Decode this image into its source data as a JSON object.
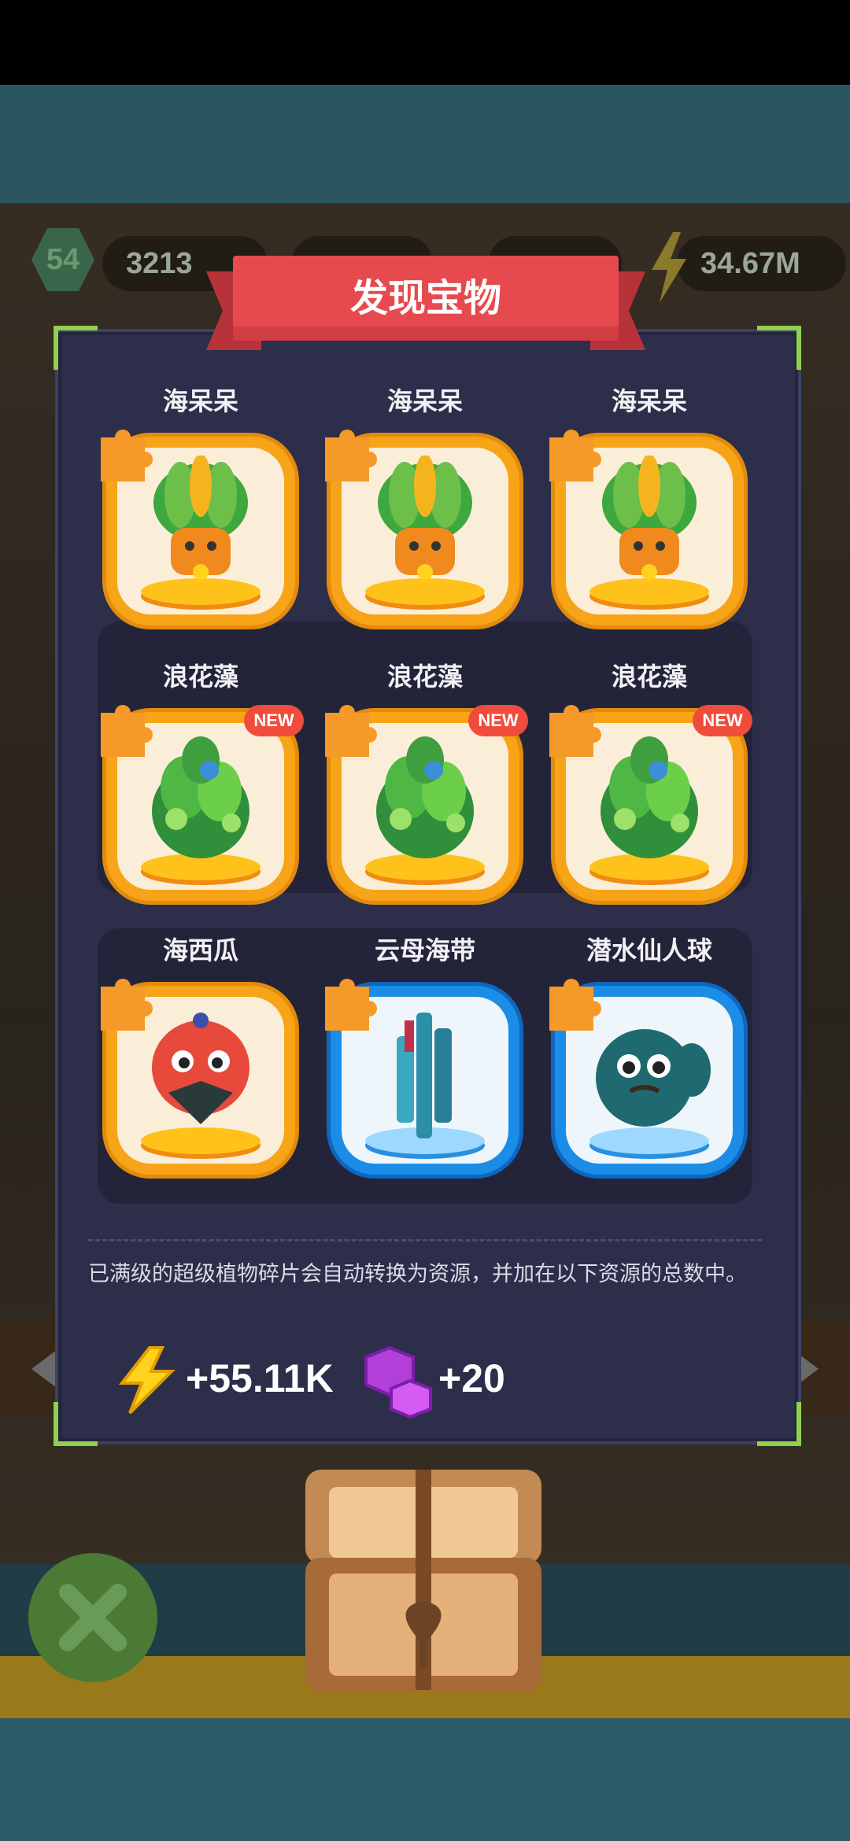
{
  "hud": {
    "level": "54",
    "coins": "3213",
    "energy": "34.67M"
  },
  "dialog": {
    "title": "发现宝物",
    "rows": [
      [
        {
          "name": "海呆呆",
          "frame": "gold",
          "new": false,
          "icon": "leafy-pineapple-plant-icon"
        },
        {
          "name": "海呆呆",
          "frame": "gold",
          "new": false,
          "icon": "leafy-pineapple-plant-icon"
        },
        {
          "name": "海呆呆",
          "frame": "gold",
          "new": false,
          "icon": "leafy-pineapple-plant-icon"
        }
      ],
      [
        {
          "name": "浪花藻",
          "frame": "gold",
          "new": true,
          "icon": "seaweed-bush-icon"
        },
        {
          "name": "浪花藻",
          "frame": "gold",
          "new": true,
          "icon": "seaweed-bush-icon"
        },
        {
          "name": "浪花藻",
          "frame": "gold",
          "new": true,
          "icon": "seaweed-bush-icon"
        }
      ],
      [
        {
          "name": "海西瓜",
          "frame": "gold",
          "new": false,
          "icon": "sea-melon-creature-icon"
        },
        {
          "name": "云母海带",
          "frame": "blue",
          "new": false,
          "icon": "mica-kelp-icon"
        },
        {
          "name": "潜水仙人球",
          "frame": "blue",
          "new": false,
          "icon": "diving-cactus-icon"
        }
      ]
    ],
    "new_badge": "NEW",
    "note": "已满级的超级植物碎片会自动转换为资源，并加在以下资源的总数中。",
    "resources": [
      {
        "icon": "lightning-bolt-icon",
        "amount": "+55.11K"
      },
      {
        "icon": "purple-gem-icon",
        "amount": "+20"
      }
    ]
  },
  "colors": {
    "ribbon": "#e64a4f",
    "gold_frame": "#f7a418",
    "blue_frame": "#1b8de6",
    "panel": "#2c2e4a",
    "corner_accent": "#8fd14f"
  }
}
